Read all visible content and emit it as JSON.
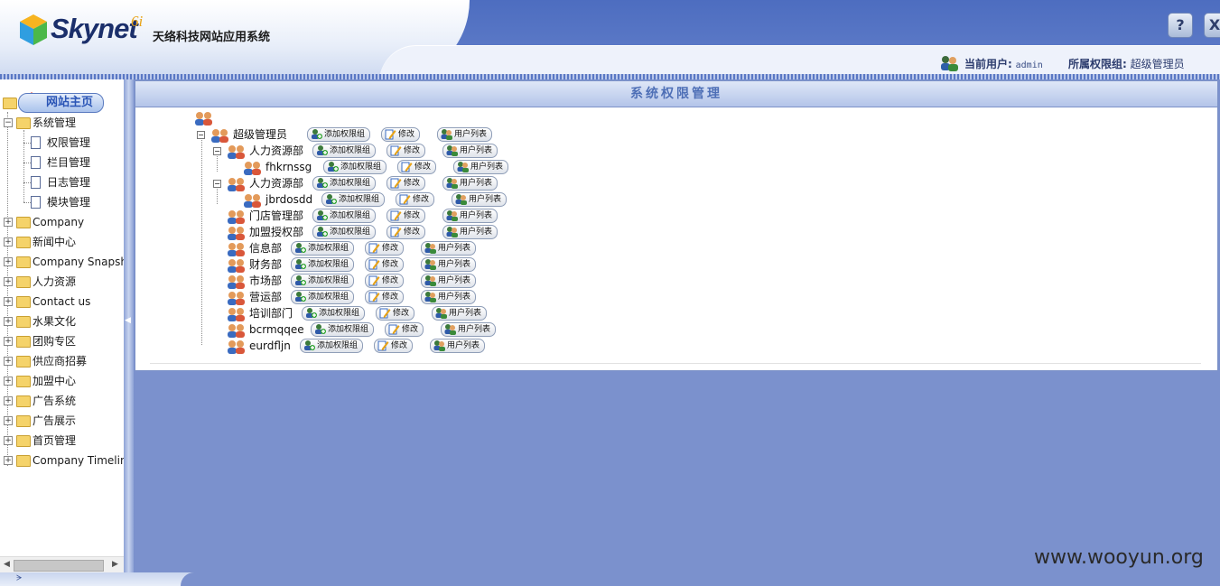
{
  "header": {
    "logo_text": "Skynet",
    "logo_sup": "6i",
    "brand": "天络科技网站应用系统",
    "help_button": "?",
    "close_button": "X",
    "current_user_label": "当前用户:",
    "current_user": "admin",
    "group_label": "所属权限组:",
    "group": "超级管理员"
  },
  "sidebar": {
    "home": "网站主页",
    "items": [
      {
        "label": "系统管理",
        "expanded": true,
        "children": [
          "权限管理",
          "栏目管理",
          "日志管理",
          "模块管理"
        ]
      },
      {
        "label": "Company"
      },
      {
        "label": "新闻中心"
      },
      {
        "label": "Company Snapshot"
      },
      {
        "label": "人力资源"
      },
      {
        "label": "Contact us"
      },
      {
        "label": "水果文化"
      },
      {
        "label": "团购专区"
      },
      {
        "label": "供应商招募"
      },
      {
        "label": "加盟中心"
      },
      {
        "label": "广告系统"
      },
      {
        "label": "广告展示"
      },
      {
        "label": "首页管理"
      },
      {
        "label": "Company Timeline"
      }
    ]
  },
  "main": {
    "title": "系统权限管理",
    "buttons": {
      "add": "添加权限组",
      "edit": "修改",
      "users": "用户列表"
    },
    "tree": [
      {
        "name": "超级管理员"
      },
      {
        "name": "人力资源部"
      },
      {
        "name": "fhkrnssg"
      },
      {
        "name": "人力资源部"
      },
      {
        "name": "jbrdosdd"
      },
      {
        "name": "门店管理部"
      },
      {
        "name": "加盟授权部"
      },
      {
        "name": "信息部"
      },
      {
        "name": "财务部"
      },
      {
        "name": "市场部"
      },
      {
        "name": "营运部"
      },
      {
        "name": "培训部门"
      },
      {
        "name": "bcrmqqee"
      },
      {
        "name": "eurdfljn"
      }
    ]
  },
  "watermark": "www.wooyun.org"
}
